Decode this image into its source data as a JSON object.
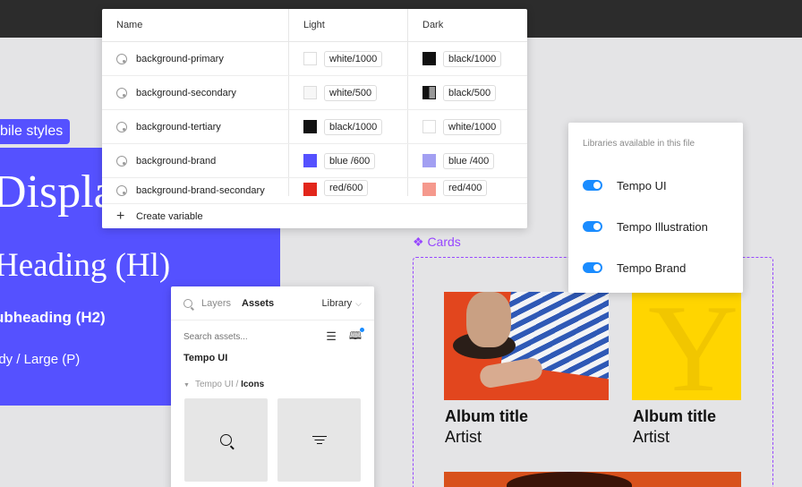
{
  "mobile_frame": {
    "tag": "bile styles",
    "display": "Display",
    "heading": "Heading (Hl)",
    "subheading": "ubheading (H2)",
    "body": "ody / Large (P)",
    "color": "#5551ff"
  },
  "variables": {
    "headers": {
      "name": "Name",
      "light": "Light",
      "dark": "Dark"
    },
    "rows": [
      {
        "name": "background-primary",
        "light": "white/1000",
        "light_color": "#ffffff",
        "dark": "black/1000",
        "dark_color": "#111111"
      },
      {
        "name": "background-secondary",
        "light": "white/500",
        "light_color": "#f7f7f7",
        "dark": "black/500",
        "dark_color": "half"
      },
      {
        "name": "background-tertiary",
        "light": "black/1000",
        "light_color": "#111111",
        "dark": "white/1000",
        "dark_color": "#ffffff"
      },
      {
        "name": "background-brand",
        "light": "blue /600",
        "light_color": "#5551ff",
        "dark": "blue /400",
        "dark_color": "#a29ff2"
      },
      {
        "name": "background-brand-secondary",
        "light": "red/600",
        "light_color": "#e2261b",
        "dark": "red/400",
        "dark_color": "#f5998d"
      }
    ],
    "create_label": "Create variable"
  },
  "libraries": {
    "title": "Libraries available in this file",
    "items": [
      "Tempo UI",
      "Tempo Illustration",
      "Tempo Brand"
    ],
    "toggle_color": "#1a8cff"
  },
  "cards": {
    "label": "❖ Cards",
    "accent": "#9747ff",
    "albums": [
      {
        "title": "Album title",
        "artist": "Artist"
      },
      {
        "title": "Album title",
        "artist": "Artist"
      }
    ],
    "cover_letter": "Y"
  },
  "assets_panel": {
    "tab_layers": "Layers",
    "tab_assets": "Assets",
    "library": "Library",
    "search_placeholder": "Search assets...",
    "section": "Tempo UI",
    "sub_prefix": "Tempo UI / ",
    "sub_name": "Icons"
  }
}
